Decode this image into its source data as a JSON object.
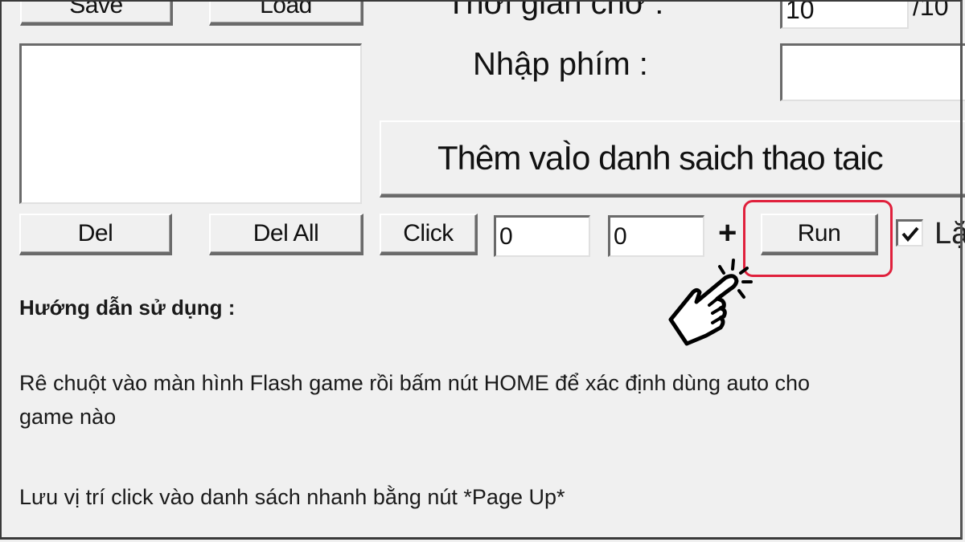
{
  "top_buttons": {
    "save": "Save",
    "load": "Load"
  },
  "wait_time": {
    "label": "Thời gian chờ :",
    "value": "10",
    "suffix": "/10"
  },
  "key_input": {
    "label": "Nhập phím :",
    "value": ""
  },
  "add_to_list_button": "Thêm vaÌo danh saich thao taic",
  "list_buttons": {
    "del": "Del",
    "del_all": "Del All"
  },
  "click_row": {
    "click_button": "Click",
    "x_value": "0",
    "y_value": "0",
    "plus_symbol": "+",
    "run_button": "Run",
    "repeat_checkbox": {
      "checked": true,
      "label_partial": "Lặ"
    }
  },
  "highlight_color": "#e0203c",
  "instructions": {
    "heading": "Hướng dẫn sử dụng :",
    "line1": "Rê chuột vào màn hình Flash game rồi bấm nút HOME để xác định dùng auto cho",
    "line1_cont": "game nào",
    "line2": "Lưu vị trí click vào danh sách nhanh bằng nút *Page Up*"
  },
  "annotation_icon": "pointing-hand-icon"
}
